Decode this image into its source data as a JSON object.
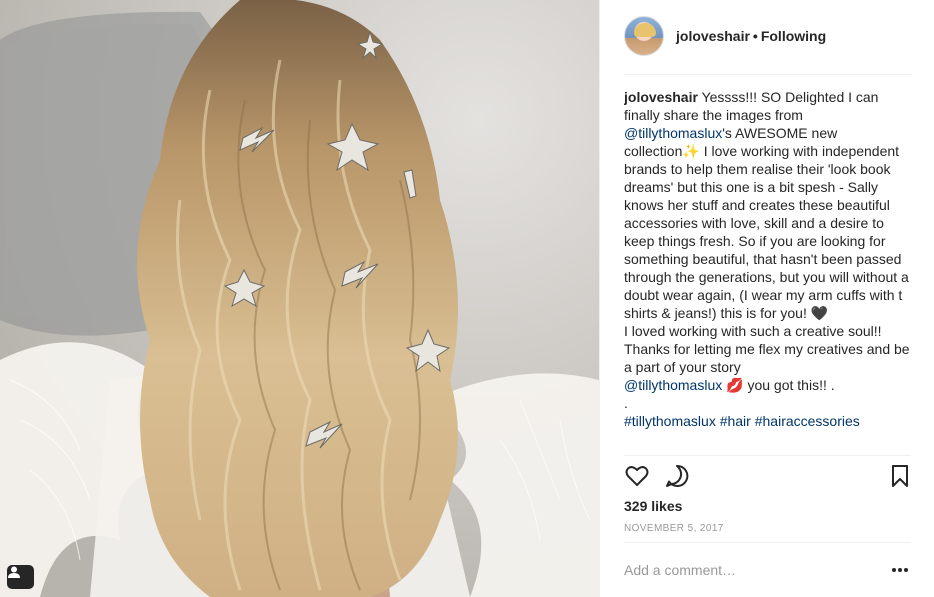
{
  "post": {
    "username": "joloveshair",
    "follow_status": "Following",
    "separator": "•"
  },
  "caption": {
    "username": "joloveshair",
    "part1": "Yessss!!! SO Delighted I can finally share the images from ",
    "mention1": "@tillythomaslux",
    "part2": "'s AWESOME new collection",
    "emoji_sparkles": "✨",
    "part3": " I love working with independent brands to help them realise their 'look book dreams' but this one is a bit spesh - Sally knows her stuff and creates these beautiful accessories with love, skill and a desire to keep things fresh. So if you are looking for something beautiful, that hasn't been passed through the generations, but you will without a doubt wear again, (I wear my arm cuffs with t shirts & jeans!) this is for you! ",
    "emoji_heart": "🖤",
    "part4": "I loved working with such a creative soul!! Thanks for letting me flex my creatives and be a part of your story",
    "mention2": "@tillythomaslux",
    "emoji_lips": "💋",
    "part5": "you got this!! .",
    "part6": ".",
    "part7": "#tillythomaslux #hair #hairaccessories"
  },
  "stats": {
    "likes": "329 likes",
    "date": "November 5, 2017"
  },
  "comment": {
    "placeholder": "Add a comment…"
  },
  "icons": {
    "like": "heart-outline-icon",
    "comment": "speech-bubble-icon",
    "save": "bookmark-icon",
    "tagged": "person-tag-icon",
    "more": "ellipsis-icon"
  }
}
